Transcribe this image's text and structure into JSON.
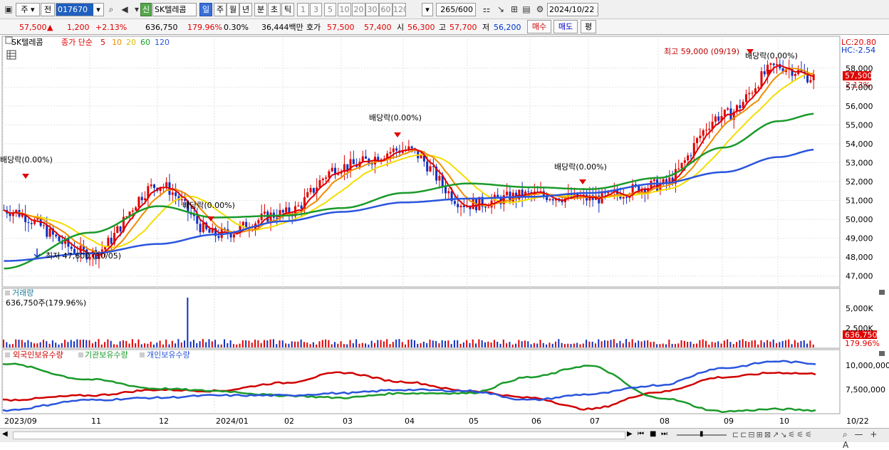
{
  "toolbar": {
    "icon_left": "window-icon",
    "market_sel": "주",
    "range_sel": "전",
    "code": "017670",
    "stock_badge": "신",
    "stock_name": "SK텔레콤",
    "period_tabs": [
      "일",
      "주",
      "월",
      "년",
      "분",
      "초",
      "틱"
    ],
    "active_period": "일",
    "num_tabs": [
      "1",
      "3",
      "5",
      "10",
      "20",
      "30",
      "60",
      "120"
    ],
    "count_cur": "265",
    "count_max": "/600",
    "date": "2024/10/22"
  },
  "quote": {
    "price": "57,500",
    "change_arrow": "▲",
    "change": "1,200",
    "change_pct": "+2.13%",
    "volume": "636,750",
    "vol_ratio": "179.96%",
    "turnover": "0.30%",
    "amount": "36,444백만",
    "ask_label": "호가",
    "ask": "57,500",
    "bid": "57,400",
    "open_label": "시",
    "open": "56,300",
    "high_label": "고",
    "high": "57,700",
    "low_label": "저",
    "low": "56,200",
    "buy_btn": "매수",
    "sell_btn": "매도",
    "eval_btn": "평"
  },
  "legend": {
    "stock": "SK텔레콤",
    "ma_label": "종가 단순",
    "ma_periods": [
      "5",
      "10",
      "20",
      "60",
      "120"
    ]
  },
  "colors": {
    "ma5": "#e00000",
    "ma10": "#f08c00",
    "ma20": "#f5dc00",
    "ma60": "#1a9a2a",
    "ma120": "#2a55dd",
    "up": "#e00000",
    "down": "#1030c0"
  },
  "annotations": {
    "lc": "LC:20.80",
    "hc": "HC:-2.54",
    "high_note": "최고 59,000 (09/19)",
    "low_note": "최저 47,600 (10/05)",
    "dividend": "배당락(0.00%)",
    "last_price": "57,500",
    "last_pct": "2.13%",
    "vol_title": "거래량",
    "vol_value": "636,750주(179.96%)",
    "vol_last": "636,750",
    "vol_last_pct": "179.96%",
    "hold_foreign": "외국인보유수량",
    "hold_inst": "기관보유수량",
    "hold_indiv": "개인보유수량"
  },
  "price_axis": [
    "58,000",
    "57,000",
    "56,000",
    "55,000",
    "54,000",
    "53,000",
    "52,000",
    "51,000",
    "50,000",
    "49,000",
    "48,000",
    "47,000"
  ],
  "vol_axis": [
    "5,000K",
    "2,500K"
  ],
  "hold_axis": [
    "10,000,000",
    "7,500,000"
  ],
  "time_axis": [
    "2023/09",
    "11",
    "12",
    "2024/01",
    "02",
    "03",
    "04",
    "05",
    "06",
    "07",
    "08",
    "09",
    "10",
    "10/22"
  ],
  "chart_data": {
    "type": "line",
    "title": "SK텔레콤",
    "price_range": [
      46500,
      59500
    ],
    "x": [
      "2023/09",
      "11",
      "12",
      "2024/01",
      "02",
      "03",
      "04",
      "05",
      "06",
      "07",
      "08",
      "09",
      "10",
      "10/22"
    ],
    "series": [
      {
        "name": "종가",
        "values": [
          50500,
          48200,
          51800,
          49200,
          50300,
          52800,
          53700,
          50800,
          51300,
          51100,
          51800,
          55500,
          58100,
          57500
        ]
      },
      {
        "name": "60",
        "values": [
          47400,
          49300,
          50700,
          50100,
          50200,
          50600,
          51400,
          51900,
          51700,
          51600,
          52200,
          53800,
          55200,
          55600
        ]
      },
      {
        "name": "120",
        "values": [
          47800,
          48200,
          48700,
          49200,
          49900,
          50400,
          50900,
          51100,
          51200,
          51400,
          51900,
          52500,
          53300,
          53700
        ]
      }
    ],
    "holdings_series": [
      {
        "name": "외국인보유수량",
        "values": [
          7.2,
          7.6,
          8.1,
          8.0,
          8.7,
          9.6,
          8.8,
          8.0,
          7.4,
          6.4,
          7.9,
          9.2,
          9.6,
          9.5
        ]
      },
      {
        "name": "기관보유수량",
        "values": [
          10.4,
          9.0,
          8.2,
          8.0,
          7.6,
          7.4,
          7.8,
          7.8,
          9.2,
          10.2,
          7.4,
          6.2,
          6.4,
          6.3
        ]
      },
      {
        "name": "개인보유수량",
        "values": [
          6.3,
          7.2,
          7.4,
          7.6,
          7.6,
          7.8,
          8.1,
          8.0,
          7.2,
          7.7,
          8.5,
          10.0,
          10.6,
          10.4
        ]
      }
    ]
  }
}
